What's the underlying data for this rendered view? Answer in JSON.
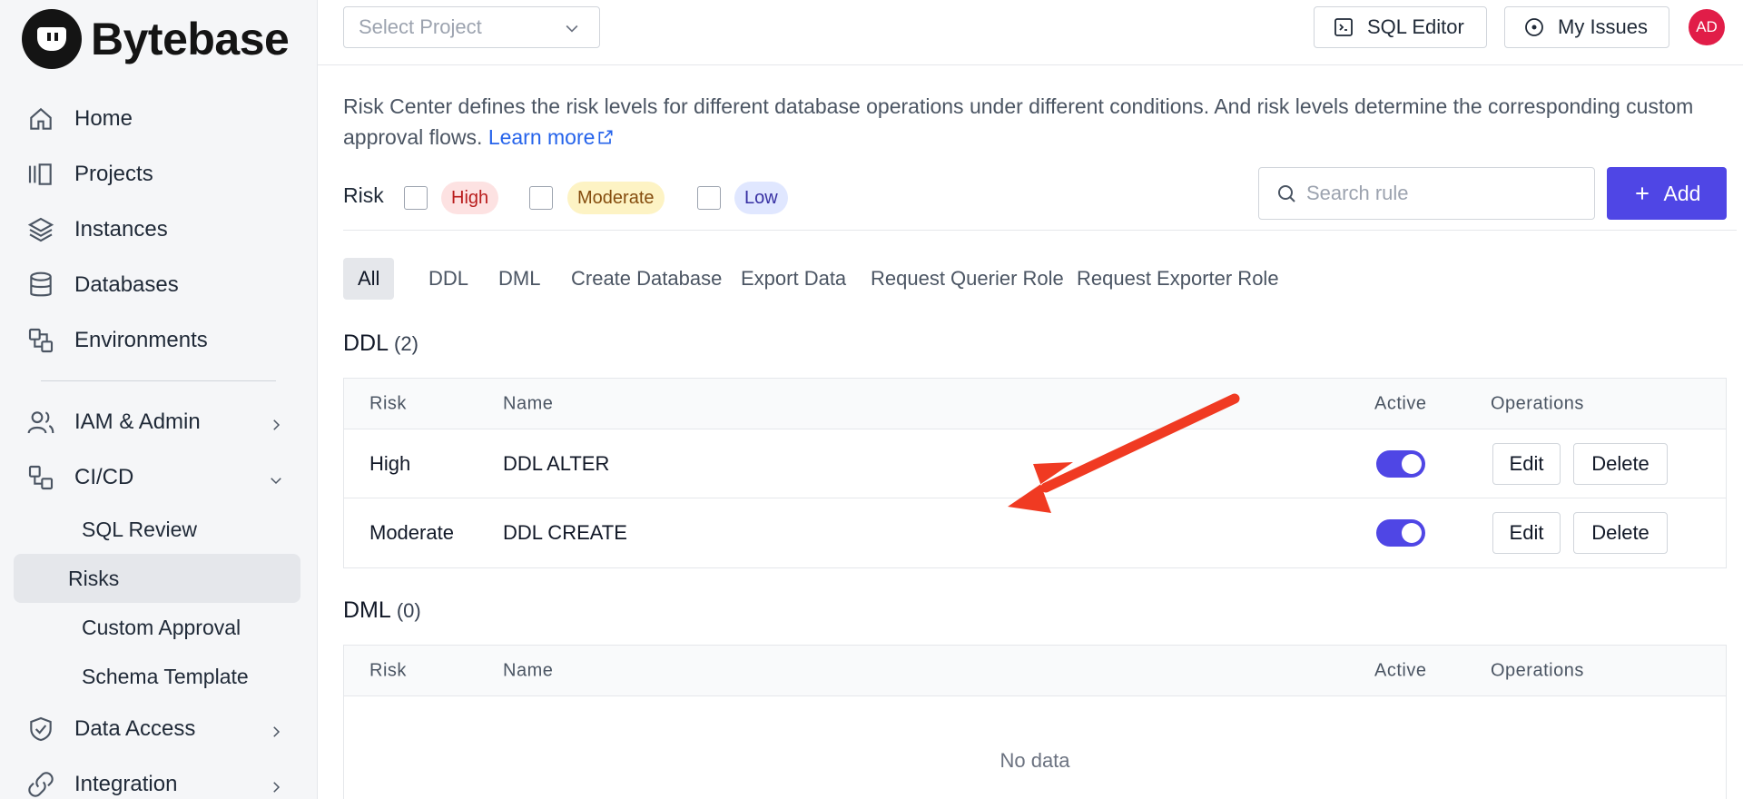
{
  "app": {
    "name": "Bytebase"
  },
  "sidebar": {
    "items": [
      {
        "label": "Home",
        "icon": "home-icon"
      },
      {
        "label": "Projects",
        "icon": "projects-icon"
      },
      {
        "label": "Instances",
        "icon": "layers-icon"
      },
      {
        "label": "Databases",
        "icon": "database-icon"
      },
      {
        "label": "Environments",
        "icon": "environments-icon"
      }
    ],
    "groups": [
      {
        "label": "IAM & Admin",
        "icon": "users-icon",
        "expanded": false
      },
      {
        "label": "CI/CD",
        "icon": "cicd-icon",
        "expanded": true,
        "children": [
          "SQL Review",
          "Risks",
          "Custom Approval",
          "Schema Template"
        ],
        "active_child": "Risks"
      },
      {
        "label": "Data Access",
        "icon": "shield-icon",
        "expanded": false
      },
      {
        "label": "Integration",
        "icon": "link-icon",
        "expanded": false
      }
    ]
  },
  "topbar": {
    "project_placeholder": "Select Project",
    "sql_editor_label": "SQL Editor",
    "my_issues_label": "My Issues",
    "avatar_initials": "AD",
    "avatar_color": "#e11d48"
  },
  "page": {
    "description": "Risk Center defines the risk levels for different database operations under different conditions. And risk levels determine the corresponding custom approval flows.",
    "learn_more": "Learn more",
    "filter": {
      "label": "Risk",
      "levels": [
        "High",
        "Moderate",
        "Low"
      ]
    },
    "search_placeholder": "Search rule",
    "add_label": "Add",
    "accent_color": "#4f46e5",
    "tabs": [
      "All",
      "DDL",
      "DML",
      "Create Database",
      "Export Data",
      "Request Querier Role",
      "Request Exporter Role"
    ],
    "active_tab": "All",
    "columns": [
      "Risk",
      "Name",
      "Active",
      "Operations"
    ],
    "sections": [
      {
        "title": "DDL",
        "count": "(2)",
        "rows": [
          {
            "risk": "High",
            "name": "DDL ALTER",
            "active": true,
            "edit": "Edit",
            "delete": "Delete"
          },
          {
            "risk": "Moderate",
            "name": "DDL CREATE",
            "active": true,
            "edit": "Edit",
            "delete": "Delete"
          }
        ]
      },
      {
        "title": "DML",
        "count": "(0)",
        "rows": [],
        "empty_text": "No data"
      }
    ]
  }
}
